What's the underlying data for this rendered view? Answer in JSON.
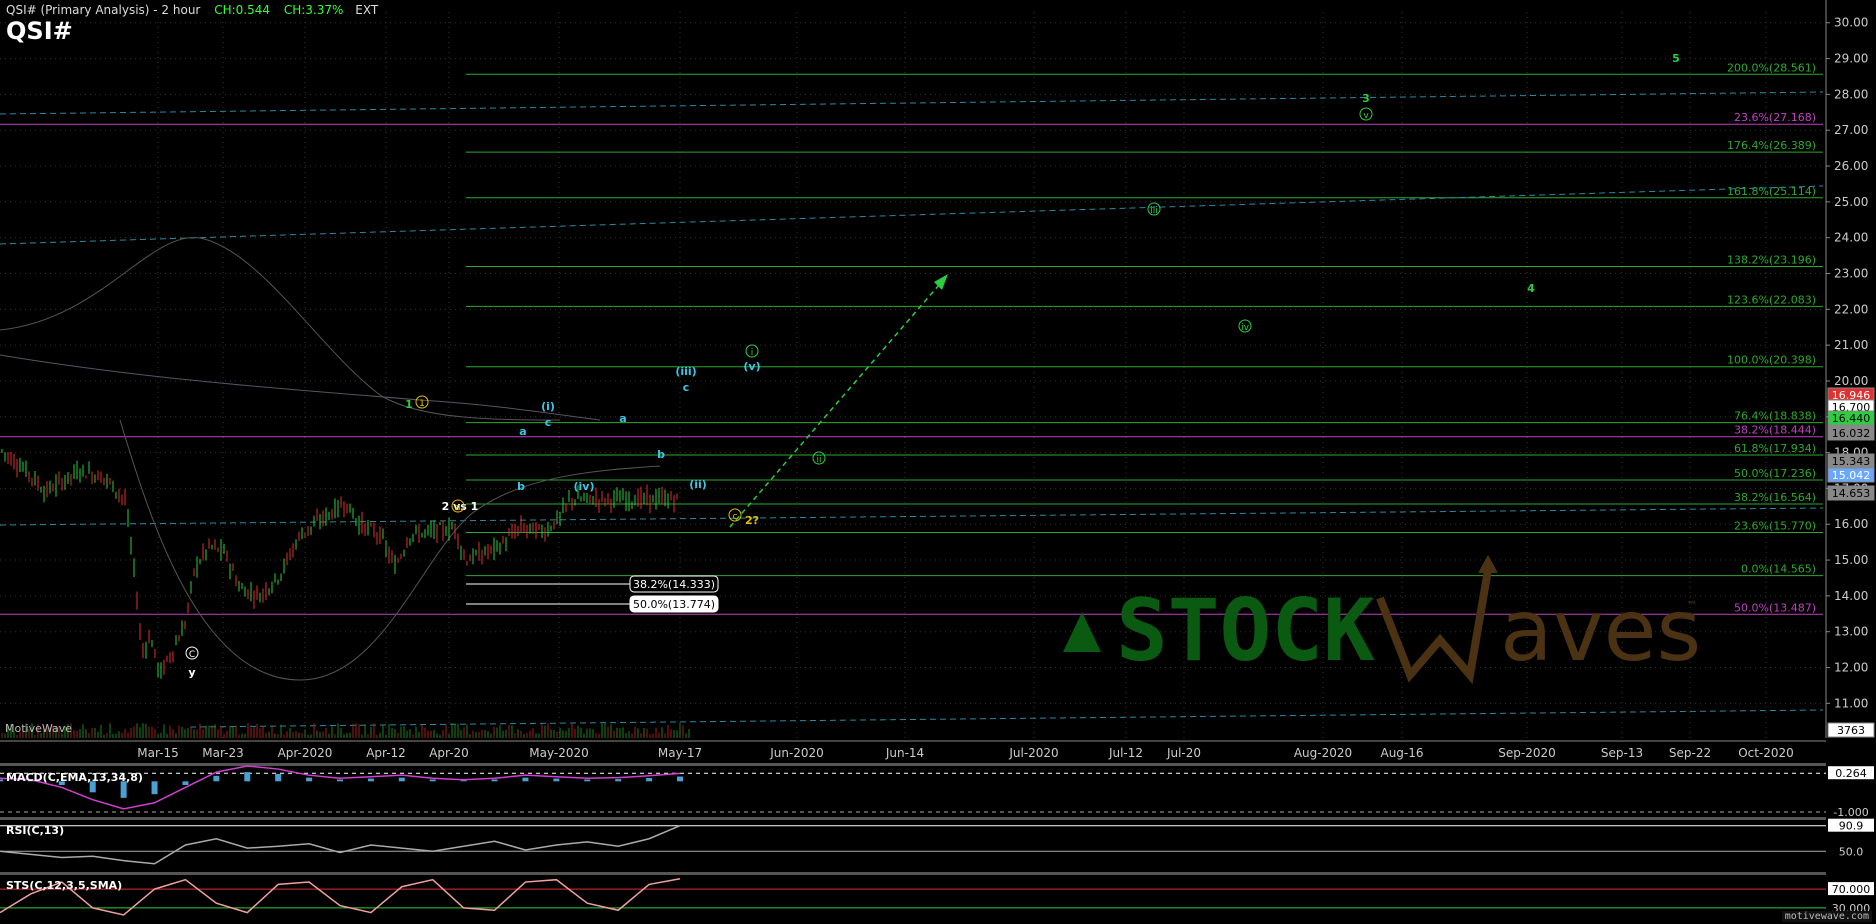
{
  "header": {
    "title": "QSI# (Primary Analysis) - 2 hour",
    "change_abs": "CH:0.544",
    "change_pct": "CH:3.37%",
    "session": "EXT",
    "symbol": "QSI#"
  },
  "watermark": {
    "motivewave": "MotiveWave",
    "footer": "motivewave.com",
    "logo_stock": "STOCK",
    "logo_waves": "Waves",
    "logo_tm": "™"
  },
  "colors": {
    "background": "#000000",
    "up": "#2ecc40",
    "down": "#e03030",
    "fib": "#2ea82e",
    "magenta": "#c040c0",
    "cyan": "#3cc6e6",
    "yellow": "#e6c000",
    "grid": "#3a3a3a"
  },
  "chart_data": [
    {
      "type": "candlestick",
      "title": "QSI# (Primary Analysis) - 2 hour",
      "ylim": [
        10.2,
        30.3
      ],
      "y_ticks": [
        "30.00",
        "29.00",
        "28.00",
        "27.00",
        "26.00",
        "25.00",
        "24.00",
        "23.00",
        "22.00",
        "21.00",
        "20.00",
        "19.00",
        "18.00",
        "17.00",
        "16.00",
        "15.00",
        "14.00",
        "13.00",
        "12.00",
        "11.00"
      ],
      "x_ticks": [
        "Mar-15",
        "Mar-23",
        "Apr-2020",
        "Apr-12",
        "Apr-20",
        "May-2020",
        "May-17",
        "Jun-2020",
        "Jun-14",
        "Jul-2020",
        "Jul-12",
        "Jul-20",
        "Aug-2020",
        "Aug-16",
        "Sep-2020",
        "Sep-13",
        "Sep-22",
        "Oct-2020"
      ],
      "price_path": [
        [
          0,
          18.1
        ],
        [
          30,
          17.4
        ],
        [
          45,
          16.9
        ],
        [
          80,
          17.5
        ],
        [
          105,
          17.3
        ],
        [
          125,
          16.7
        ],
        [
          135,
          14.5
        ],
        [
          142,
          12.4
        ],
        [
          150,
          12.9
        ],
        [
          160,
          11.8
        ],
        [
          175,
          12.6
        ],
        [
          185,
          13.2
        ],
        [
          195,
          14.8
        ],
        [
          210,
          15.4
        ],
        [
          225,
          15.2
        ],
        [
          240,
          14.2
        ],
        [
          260,
          14.0
        ],
        [
          280,
          14.6
        ],
        [
          300,
          15.7
        ],
        [
          320,
          16.1
        ],
        [
          345,
          16.6
        ],
        [
          360,
          16.0
        ],
        [
          380,
          15.7
        ],
        [
          395,
          14.8
        ],
        [
          410,
          15.7
        ],
        [
          435,
          15.8
        ],
        [
          455,
          15.9
        ],
        [
          465,
          15.0
        ],
        [
          485,
          15.2
        ],
        [
          500,
          15.4
        ],
        [
          520,
          15.9
        ],
        [
          545,
          15.8
        ],
        [
          560,
          16.2
        ],
        [
          570,
          16.7
        ]
      ],
      "price_labels": [
        {
          "value": "16.946",
          "color": "#e03030"
        },
        {
          "value": "16.700",
          "color": "#ffffff"
        },
        {
          "value": "16.440",
          "color": "#2ecc40"
        },
        {
          "value": "16.032",
          "color": "#888888"
        },
        {
          "value": "15.343",
          "color": "#888888"
        },
        {
          "value": "15.042",
          "color": "#6aa8ff"
        },
        {
          "value": "14.653",
          "color": "#888888"
        },
        {
          "value": "3763",
          "color": "#ffffff"
        }
      ],
      "fib_levels": [
        {
          "label": "200.0%(28.561)",
          "price": 28.561,
          "color": "#2ea82e"
        },
        {
          "label": "23.6%(27.168)",
          "price": 27.168,
          "color": "#c040c0"
        },
        {
          "label": "176.4%(26.389)",
          "price": 26.389,
          "color": "#2ea82e"
        },
        {
          "label": "161.8%(25.114)",
          "price": 25.114,
          "color": "#2ea82e"
        },
        {
          "label": "138.2%(23.196)",
          "price": 23.196,
          "color": "#2ea82e"
        },
        {
          "label": "123.6%(22.083)",
          "price": 22.083,
          "color": "#2ea82e"
        },
        {
          "label": "100.0%(20.398)",
          "price": 20.398,
          "color": "#2ea82e"
        },
        {
          "label": "76.4%(18.838)",
          "price": 18.838,
          "color": "#2ea82e"
        },
        {
          "label": "38.2%(18.444)",
          "price": 18.444,
          "color": "#c040c0"
        },
        {
          "label": "61.8%(17.934)",
          "price": 17.934,
          "color": "#2ea82e"
        },
        {
          "label": "50.0%(17.236)",
          "price": 17.236,
          "color": "#2ea82e"
        },
        {
          "label": "38.2%(16.564)",
          "price": 16.564,
          "color": "#2ea82e"
        },
        {
          "label": "23.6%(15.770)",
          "price": 15.77,
          "color": "#2ea82e"
        },
        {
          "label": "0.0%(14.565)",
          "price": 14.565,
          "color": "#2ea82e"
        },
        {
          "label": "50.0%(13.487)",
          "price": 13.487,
          "color": "#c040c0"
        }
      ],
      "retracement_boxes": [
        {
          "label": "38.2%(14.333)",
          "price": 14.333
        },
        {
          "label": "50.0%(13.774)",
          "price": 13.774
        }
      ],
      "annotations": [
        {
          "text": "5",
          "color": "#2ecc40",
          "at": [
            "Sep-2020+",
            "28.6"
          ]
        },
        {
          "text": "3",
          "color": "#2ecc40",
          "at": [
            "Aug-2020+",
            "26.4"
          ]
        },
        {
          "text": "v",
          "color": "#2ecc40",
          "circled": true
        },
        {
          "text": "iii",
          "color": "#2ecc40",
          "circled": true
        },
        {
          "text": "4",
          "color": "#2ecc40"
        },
        {
          "text": "iv",
          "color": "#2ecc40",
          "circled": true
        },
        {
          "text": "i",
          "color": "#2ecc40",
          "circled": true
        },
        {
          "text": "(v)",
          "color": "#3cc6e6"
        },
        {
          "text": "ii",
          "color": "#2ecc40",
          "circled": true
        },
        {
          "text": "(iii)",
          "color": "#3cc6e6"
        },
        {
          "text": "c",
          "color": "#3cc6e6"
        },
        {
          "text": "1",
          "color": "#e6c000",
          "circled": true
        },
        {
          "text": "1",
          "color": "#2ecc40"
        },
        {
          "text": "(i)",
          "color": "#3cc6e6"
        },
        {
          "text": "c",
          "color": "#3cc6e6"
        },
        {
          "text": "a",
          "color": "#3cc6e6"
        },
        {
          "text": "a",
          "color": "#3cc6e6"
        },
        {
          "text": "b",
          "color": "#3cc6e6"
        },
        {
          "text": "b",
          "color": "#3cc6e6"
        },
        {
          "text": "(iv)",
          "color": "#3cc6e6"
        },
        {
          "text": "(ii)",
          "color": "#3cc6e6"
        },
        {
          "text": "2 vs 1",
          "color": "#ffffff"
        },
        {
          "text": "a",
          "color": "#e6c000",
          "circled": true
        },
        {
          "text": "c",
          "color": "#e6c000",
          "circled": true
        },
        {
          "text": "2?",
          "color": "#e6c000"
        },
        {
          "text": "C",
          "color": "#ffffff",
          "circled": true
        },
        {
          "text": "y",
          "color": "#ffffff"
        }
      ]
    },
    {
      "type": "line",
      "title": "MACD(C,EMA,13,34,8)",
      "value_labels": [
        "0.264",
        "-1.000"
      ],
      "series": [
        {
          "name": "MACD(C,EMA,13,34,8)",
          "values": [
            0.1,
            0.05,
            -0.2,
            -0.6,
            -0.9,
            -0.7,
            -0.2,
            0.3,
            0.5,
            0.4,
            0.2,
            0.1,
            0.15,
            0.2,
            0.1,
            0.05,
            0.1,
            0.2,
            0.15,
            0.1,
            0.12,
            0.18,
            0.26
          ]
        }
      ]
    },
    {
      "type": "line",
      "title": "RSI(C,13)",
      "value_labels": [
        "90.9",
        "50.0"
      ],
      "series": [
        {
          "name": "RSI(C,13)",
          "values": [
            50,
            45,
            40,
            42,
            35,
            30,
            60,
            70,
            55,
            58,
            62,
            48,
            60,
            55,
            50,
            58,
            66,
            52,
            60,
            65,
            58,
            70,
            90.9
          ]
        }
      ]
    },
    {
      "type": "line",
      "title": "STS(C,12,3,5,SMA)",
      "value_labels": [
        "70.000",
        "30.000"
      ],
      "series": [
        {
          "name": "STS(C,12,3,5,SMA)",
          "values": [
            20,
            60,
            85,
            30,
            15,
            70,
            90,
            40,
            20,
            80,
            85,
            35,
            20,
            75,
            90,
            30,
            25,
            85,
            90,
            40,
            25,
            80,
            92
          ]
        }
      ]
    }
  ]
}
